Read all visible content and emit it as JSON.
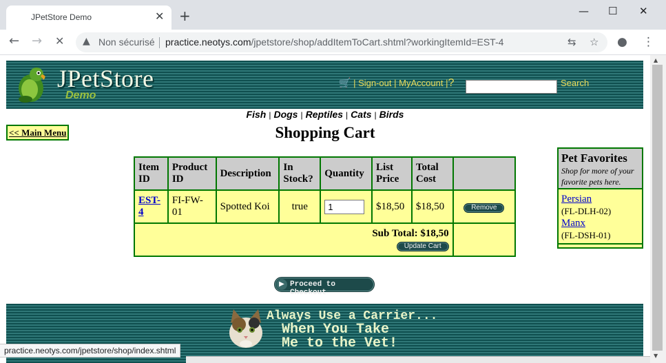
{
  "browser": {
    "tab_title": "JPetStore Demo",
    "tab_close": "✕",
    "new_tab": "+",
    "window_controls": {
      "minimize": "—",
      "maximize": "☐",
      "close": "✕"
    },
    "nav": {
      "back": "←",
      "forward": "→",
      "stop": "✕"
    },
    "security_label": "Non sécurisé",
    "url_host": "practice.neotys.com",
    "url_path": "/jpetstore/shop/addItemToCart.shtml?workingItemId=EST-4",
    "status_url": "practice.neotys.com/jpetstore/shop/index.shtml"
  },
  "header": {
    "logo_text": "JPetStore",
    "logo_sub": "Demo",
    "sign_out": "Sign-out",
    "my_account": "MyAccount",
    "search_value": "",
    "search_label": "Search",
    "icons": {
      "cart": "cart-icon",
      "help": "help-icon"
    }
  },
  "quicklinks": [
    "Fish",
    "Dogs",
    "Reptiles",
    "Cats",
    "Birds"
  ],
  "main_menu_label": "<< Main Menu",
  "page_title": "Shopping Cart",
  "cart": {
    "headers": [
      "Item ID",
      "Product ID",
      "Description",
      "In Stock?",
      "Quantity",
      "List Price",
      "Total Cost",
      ""
    ],
    "rows": [
      {
        "item_id": "EST-4",
        "product_id": "FI-FW-01",
        "description": "Spotted Koi",
        "in_stock": "true",
        "quantity": "1",
        "list_price": "$18,50",
        "total_cost": "$18,50",
        "remove_label": "Remove"
      }
    ],
    "subtotal": "Sub Total: $18,50",
    "update_label": "Update Cart"
  },
  "checkout_label": "Proceed to Checkout",
  "favorites": {
    "title": "Pet Favorites",
    "subtitle": "Shop for more of your favorite pets here.",
    "items": [
      {
        "name": "Persian",
        "code": "(FL-DLH-02)"
      },
      {
        "name": "Manx",
        "code": "(FL-DSH-01)"
      }
    ]
  },
  "banner": {
    "line1": "Always Use a Carrier...",
    "line2": "When You Take",
    "line3": "Me to the Vet!"
  },
  "colors": {
    "header_dark": "#0f4f4f",
    "link_yellow": "#eadb58",
    "table_bg": "#ffff99",
    "table_border": "#007700",
    "header_cell": "#cccccc"
  }
}
